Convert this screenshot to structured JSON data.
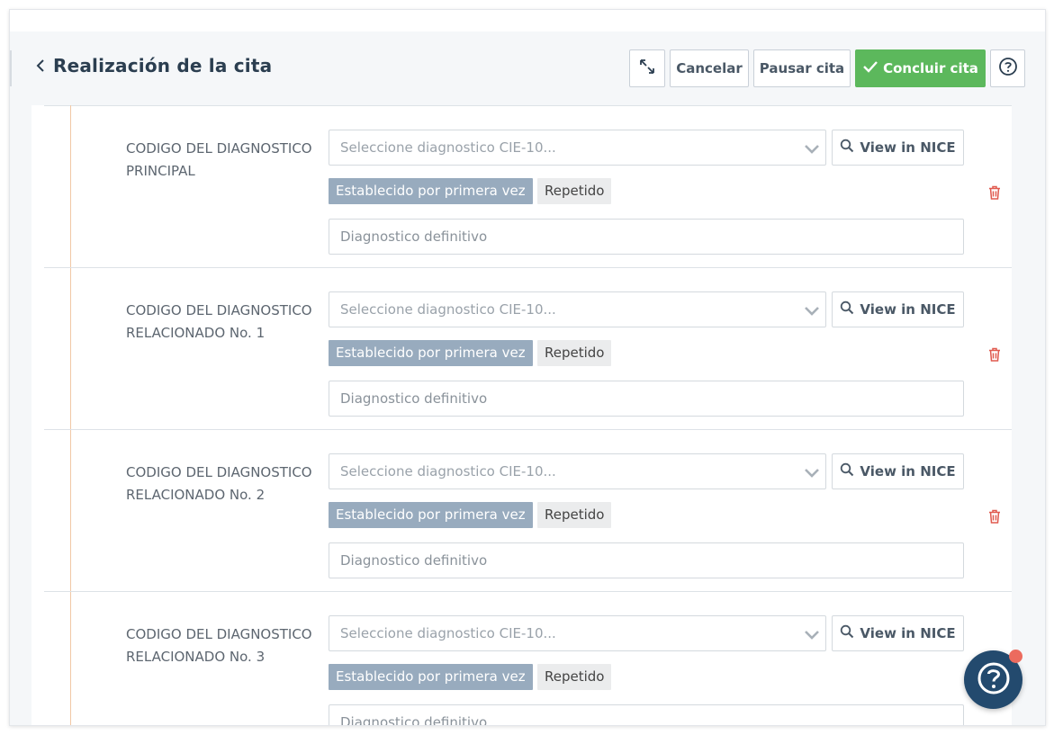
{
  "header": {
    "title": "Realización de la cita",
    "buttons": {
      "cancel": "Cancelar",
      "pause": "Pausar cita",
      "conclude": "Concluir cita"
    }
  },
  "icons": {
    "back": "chevron-left-icon",
    "expand": "expand-arrows-icon",
    "check": "checkmark-icon",
    "help": "question-circle-icon",
    "search": "search-icon",
    "caret": "chevron-down-icon",
    "delete": "trash-icon"
  },
  "colors": {
    "conclude_button": "#5cb85c",
    "tag_primary": "#98abbe",
    "tag_secondary": "#ebeced",
    "delete_icon": "#e05a4f",
    "fab_background": "#234a6e",
    "notification_dot": "#ec6b5e"
  },
  "diagnoses": [
    {
      "label": "CODIGO DEL DIAGNOSTICO PRINCIPAL",
      "select_placeholder": "Seleccione diagnostico CIE-10...",
      "nice_button": "View in NICE",
      "tag_first": "Establecido por primera vez",
      "tag_repeat": "Repetido",
      "definitive_placeholder": "Diagnostico definitivo"
    },
    {
      "label": "CODIGO DEL DIAGNOSTICO RELACIONADO No. 1",
      "select_placeholder": "Seleccione diagnostico CIE-10...",
      "nice_button": "View in NICE",
      "tag_first": "Establecido por primera vez",
      "tag_repeat": "Repetido",
      "definitive_placeholder": "Diagnostico definitivo"
    },
    {
      "label": "CODIGO DEL DIAGNOSTICO RELACIONADO No. 2",
      "select_placeholder": "Seleccione diagnostico CIE-10...",
      "nice_button": "View in NICE",
      "tag_first": "Establecido por primera vez",
      "tag_repeat": "Repetido",
      "definitive_placeholder": "Diagnostico definitivo"
    },
    {
      "label": "CODIGO DEL DIAGNOSTICO RELACIONADO No. 3",
      "select_placeholder": "Seleccione diagnostico CIE-10...",
      "nice_button": "View in NICE",
      "tag_first": "Establecido por primera vez",
      "tag_repeat": "Repetido",
      "definitive_placeholder": "Diagnostico definitivo"
    }
  ]
}
